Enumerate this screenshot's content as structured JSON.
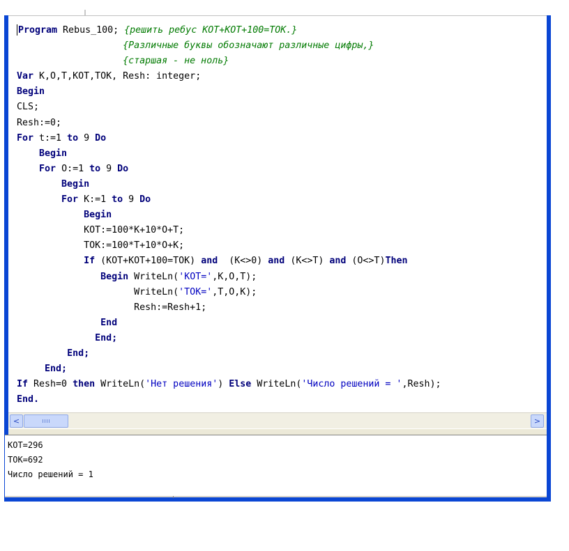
{
  "editor": {
    "lines": [
      {
        "indent": "",
        "tokens": [
          {
            "t": "Program",
            "c": "kw"
          },
          {
            "t": " Rebus_100; ",
            "c": ""
          },
          {
            "t": "{решить ребус КОТ+КОТ+100=ТОК.}",
            "c": "cm"
          }
        ]
      },
      {
        "indent": "                   ",
        "tokens": [
          {
            "t": "{Различные буквы обозначают различные цифры,}",
            "c": "cm"
          }
        ]
      },
      {
        "indent": "                   ",
        "tokens": [
          {
            "t": "{старшая - не ноль}",
            "c": "cm"
          }
        ]
      },
      {
        "indent": "",
        "tokens": [
          {
            "t": "Var",
            "c": "kw"
          },
          {
            "t": " K,O,T,KOT,TOK, Resh: integer;",
            "c": ""
          }
        ]
      },
      {
        "indent": "",
        "tokens": [
          {
            "t": "Begin",
            "c": "kw"
          }
        ]
      },
      {
        "indent": "",
        "tokens": [
          {
            "t": "CLS;",
            "c": ""
          }
        ]
      },
      {
        "indent": "",
        "tokens": [
          {
            "t": "Resh:=0;",
            "c": ""
          }
        ]
      },
      {
        "indent": "",
        "tokens": [
          {
            "t": "For",
            "c": "kw"
          },
          {
            "t": " t:=1 ",
            "c": ""
          },
          {
            "t": "to",
            "c": "kw"
          },
          {
            "t": " 9 ",
            "c": ""
          },
          {
            "t": "Do",
            "c": "kw"
          }
        ]
      },
      {
        "indent": "    ",
        "tokens": [
          {
            "t": "Begin",
            "c": "kw"
          }
        ]
      },
      {
        "indent": "    ",
        "tokens": [
          {
            "t": "For",
            "c": "kw"
          },
          {
            "t": " O:=1 ",
            "c": ""
          },
          {
            "t": "to",
            "c": "kw"
          },
          {
            "t": " 9 ",
            "c": ""
          },
          {
            "t": "Do",
            "c": "kw"
          }
        ]
      },
      {
        "indent": "        ",
        "tokens": [
          {
            "t": "Begin",
            "c": "kw"
          }
        ]
      },
      {
        "indent": "        ",
        "tokens": [
          {
            "t": "For",
            "c": "kw"
          },
          {
            "t": " K:=1 ",
            "c": ""
          },
          {
            "t": "to",
            "c": "kw"
          },
          {
            "t": " 9 ",
            "c": ""
          },
          {
            "t": "Do",
            "c": "kw"
          }
        ]
      },
      {
        "indent": "            ",
        "tokens": [
          {
            "t": "Begin",
            "c": "kw"
          }
        ]
      },
      {
        "indent": "            ",
        "tokens": [
          {
            "t": "KOT:=100*K+10*O+T;",
            "c": ""
          }
        ]
      },
      {
        "indent": "            ",
        "tokens": [
          {
            "t": "TOK:=100*T+10*O+K;",
            "c": ""
          }
        ]
      },
      {
        "indent": "            ",
        "tokens": [
          {
            "t": "If",
            "c": "kw"
          },
          {
            "t": " (KOT+KOT+100=TOK) ",
            "c": ""
          },
          {
            "t": "and",
            "c": "kw"
          },
          {
            "t": "  (K<>0) ",
            "c": ""
          },
          {
            "t": "and",
            "c": "kw"
          },
          {
            "t": " (K<>T) ",
            "c": ""
          },
          {
            "t": "and",
            "c": "kw"
          },
          {
            "t": " (O<>T)",
            "c": ""
          },
          {
            "t": "Then",
            "c": "kw"
          }
        ]
      },
      {
        "indent": "               ",
        "tokens": [
          {
            "t": "Begin",
            "c": "kw"
          },
          {
            "t": " WriteLn(",
            "c": ""
          },
          {
            "t": "'KOT='",
            "c": "str"
          },
          {
            "t": ",K,O,T);",
            "c": ""
          }
        ]
      },
      {
        "indent": "                     ",
        "tokens": [
          {
            "t": "WriteLn(",
            "c": ""
          },
          {
            "t": "'TOK='",
            "c": "str"
          },
          {
            "t": ",T,O,K);",
            "c": ""
          }
        ]
      },
      {
        "indent": "                     ",
        "tokens": [
          {
            "t": "Resh:=Resh+1;",
            "c": ""
          }
        ]
      },
      {
        "indent": "               ",
        "tokens": [
          {
            "t": "End",
            "c": "kw"
          }
        ]
      },
      {
        "indent": "              ",
        "tokens": [
          {
            "t": "End;",
            "c": "kw"
          }
        ]
      },
      {
        "indent": "         ",
        "tokens": [
          {
            "t": "End;",
            "c": "kw"
          }
        ]
      },
      {
        "indent": "     ",
        "tokens": [
          {
            "t": "End;",
            "c": "kw"
          }
        ]
      },
      {
        "indent": "",
        "tokens": [
          {
            "t": "If",
            "c": "kw"
          },
          {
            "t": " Resh=0 ",
            "c": ""
          },
          {
            "t": "then",
            "c": "kw"
          },
          {
            "t": " WriteLn(",
            "c": ""
          },
          {
            "t": "'Нет решения'",
            "c": "str"
          },
          {
            "t": ") ",
            "c": ""
          },
          {
            "t": "Else",
            "c": "kw"
          },
          {
            "t": " WriteLn(",
            "c": ""
          },
          {
            "t": "'Число решений = '",
            "c": "str"
          },
          {
            "t": ",Resh);",
            "c": ""
          }
        ]
      },
      {
        "indent": "",
        "tokens": [
          {
            "t": "End.",
            "c": "kw"
          }
        ]
      }
    ]
  },
  "scrollbar": {
    "left_icon": "chevron-left-icon",
    "right_icon": "chevron-right-icon",
    "left_glyph": "<",
    "right_glyph": ">"
  },
  "output": {
    "lines": [
      "KOT=296",
      "TOK=692",
      "Число решений = 1"
    ]
  },
  "colors": {
    "keyword": "#00007a",
    "comment": "#007a00",
    "string": "#0000c0",
    "frame": "#0a46d4"
  }
}
